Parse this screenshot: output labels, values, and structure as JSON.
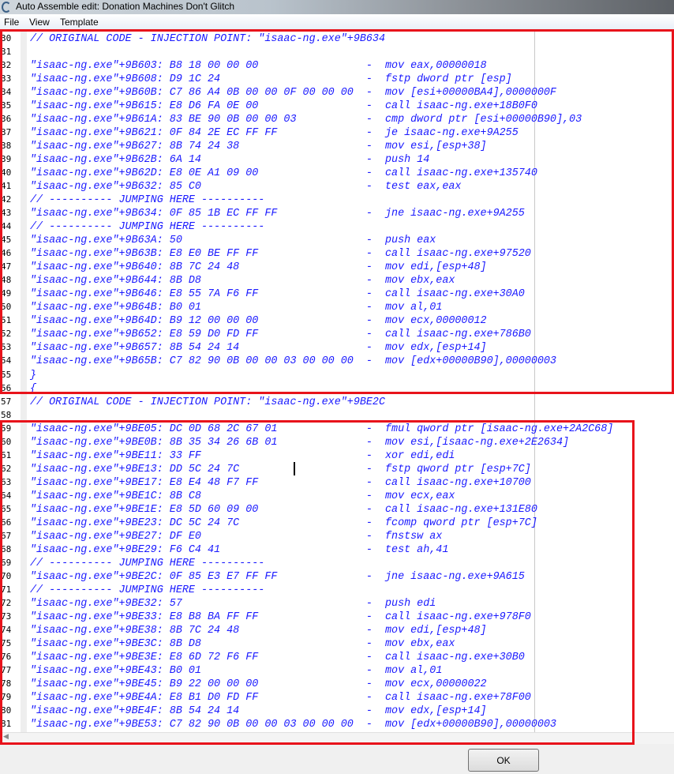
{
  "window": {
    "title": "Auto Assemble edit: Donation Machines Don't Glitch"
  },
  "menu": [
    "File",
    "View",
    "Template"
  ],
  "lines": [
    {
      "n": "30",
      "t": "// ORIGINAL CODE - INJECTION POINT: \"isaac-ng.exe\"+9B634"
    },
    {
      "n": "31",
      "t": ""
    },
    {
      "n": "32",
      "t": "\"isaac-ng.exe\"+9B603: B8 18 00 00 00                 -  mov eax,00000018"
    },
    {
      "n": "33",
      "t": "\"isaac-ng.exe\"+9B608: D9 1C 24                       -  fstp dword ptr [esp]"
    },
    {
      "n": "34",
      "t": "\"isaac-ng.exe\"+9B60B: C7 86 A4 0B 00 00 0F 00 00 00  -  mov [esi+00000BA4],0000000F"
    },
    {
      "n": "35",
      "t": "\"isaac-ng.exe\"+9B615: E8 D6 FA 0E 00                 -  call isaac-ng.exe+18B0F0"
    },
    {
      "n": "36",
      "t": "\"isaac-ng.exe\"+9B61A: 83 BE 90 0B 00 00 03           -  cmp dword ptr [esi+00000B90],03"
    },
    {
      "n": "37",
      "t": "\"isaac-ng.exe\"+9B621: 0F 84 2E EC FF FF              -  je isaac-ng.exe+9A255"
    },
    {
      "n": "38",
      "t": "\"isaac-ng.exe\"+9B627: 8B 74 24 38                    -  mov esi,[esp+38]"
    },
    {
      "n": "39",
      "t": "\"isaac-ng.exe\"+9B62B: 6A 14                          -  push 14"
    },
    {
      "n": "40",
      "t": "\"isaac-ng.exe\"+9B62D: E8 0E A1 09 00                 -  call isaac-ng.exe+135740"
    },
    {
      "n": "41",
      "t": "\"isaac-ng.exe\"+9B632: 85 C0                          -  test eax,eax"
    },
    {
      "n": "42",
      "t": "// ---------- JUMPING HERE ----------"
    },
    {
      "n": "43",
      "t": "\"isaac-ng.exe\"+9B634: 0F 85 1B EC FF FF              -  jne isaac-ng.exe+9A255"
    },
    {
      "n": "44",
      "t": "// ---------- JUMPING HERE ----------"
    },
    {
      "n": "45",
      "t": "\"isaac-ng.exe\"+9B63A: 50                             -  push eax"
    },
    {
      "n": "46",
      "t": "\"isaac-ng.exe\"+9B63B: E8 E0 BE FF FF                 -  call isaac-ng.exe+97520"
    },
    {
      "n": "47",
      "t": "\"isaac-ng.exe\"+9B640: 8B 7C 24 48                    -  mov edi,[esp+48]"
    },
    {
      "n": "48",
      "t": "\"isaac-ng.exe\"+9B644: 8B D8                          -  mov ebx,eax"
    },
    {
      "n": "49",
      "t": "\"isaac-ng.exe\"+9B646: E8 55 7A F6 FF                 -  call isaac-ng.exe+30A0"
    },
    {
      "n": "50",
      "t": "\"isaac-ng.exe\"+9B64B: B0 01                          -  mov al,01"
    },
    {
      "n": "51",
      "t": "\"isaac-ng.exe\"+9B64D: B9 12 00 00 00                 -  mov ecx,00000012"
    },
    {
      "n": "52",
      "t": "\"isaac-ng.exe\"+9B652: E8 59 D0 FD FF                 -  call isaac-ng.exe+786B0"
    },
    {
      "n": "53",
      "t": "\"isaac-ng.exe\"+9B657: 8B 54 24 14                    -  mov edx,[esp+14]"
    },
    {
      "n": "54",
      "t": "\"isaac-ng.exe\"+9B65B: C7 82 90 0B 00 00 03 00 00 00  -  mov [edx+00000B90],00000003"
    },
    {
      "n": "55",
      "t": "}"
    },
    {
      "n": "56",
      "t": "{"
    },
    {
      "n": "57",
      "t": "// ORIGINAL CODE - INJECTION POINT: \"isaac-ng.exe\"+9BE2C"
    },
    {
      "n": "58",
      "t": ""
    },
    {
      "n": "59",
      "t": "\"isaac-ng.exe\"+9BE05: DC 0D 68 2C 67 01              -  fmul qword ptr [isaac-ng.exe+2A2C68]"
    },
    {
      "n": "60",
      "t": "\"isaac-ng.exe\"+9BE0B: 8B 35 34 26 6B 01              -  mov esi,[isaac-ng.exe+2E2634]"
    },
    {
      "n": "61",
      "t": "\"isaac-ng.exe\"+9BE11: 33 FF                          -  xor edi,edi"
    },
    {
      "n": "62",
      "t": "\"isaac-ng.exe\"+9BE13: DD 5C 24 7C                    -  fstp qword ptr [esp+7C]"
    },
    {
      "n": "63",
      "t": "\"isaac-ng.exe\"+9BE17: E8 E4 48 F7 FF                 -  call isaac-ng.exe+10700"
    },
    {
      "n": "64",
      "t": "\"isaac-ng.exe\"+9BE1C: 8B C8                          -  mov ecx,eax"
    },
    {
      "n": "65",
      "t": "\"isaac-ng.exe\"+9BE1E: E8 5D 60 09 00                 -  call isaac-ng.exe+131E80"
    },
    {
      "n": "66",
      "t": "\"isaac-ng.exe\"+9BE23: DC 5C 24 7C                    -  fcomp qword ptr [esp+7C]"
    },
    {
      "n": "67",
      "t": "\"isaac-ng.exe\"+9BE27: DF E0                          -  fnstsw ax"
    },
    {
      "n": "68",
      "t": "\"isaac-ng.exe\"+9BE29: F6 C4 41                       -  test ah,41"
    },
    {
      "n": "69",
      "t": "// ---------- JUMPING HERE ----------"
    },
    {
      "n": "70",
      "t": "\"isaac-ng.exe\"+9BE2C: 0F 85 E3 E7 FF FF              -  jne isaac-ng.exe+9A615"
    },
    {
      "n": "71",
      "t": "// ---------- JUMPING HERE ----------"
    },
    {
      "n": "72",
      "t": "\"isaac-ng.exe\"+9BE32: 57                             -  push edi"
    },
    {
      "n": "73",
      "t": "\"isaac-ng.exe\"+9BE33: E8 B8 BA FF FF                 -  call isaac-ng.exe+978F0"
    },
    {
      "n": "74",
      "t": "\"isaac-ng.exe\"+9BE38: 8B 7C 24 48                    -  mov edi,[esp+48]"
    },
    {
      "n": "75",
      "t": "\"isaac-ng.exe\"+9BE3C: 8B D8                          -  mov ebx,eax"
    },
    {
      "n": "76",
      "t": "\"isaac-ng.exe\"+9BE3E: E8 6D 72 F6 FF                 -  call isaac-ng.exe+30B0"
    },
    {
      "n": "77",
      "t": "\"isaac-ng.exe\"+9BE43: B0 01                          -  mov al,01"
    },
    {
      "n": "78",
      "t": "\"isaac-ng.exe\"+9BE45: B9 22 00 00 00                 -  mov ecx,00000022"
    },
    {
      "n": "79",
      "t": "\"isaac-ng.exe\"+9BE4A: E8 B1 D0 FD FF                 -  call isaac-ng.exe+78F00"
    },
    {
      "n": "80",
      "t": "\"isaac-ng.exe\"+9BE4F: 8B 54 24 14                    -  mov edx,[esp+14]"
    },
    {
      "n": "81",
      "t": "\"isaac-ng.exe\"+9BE53: C7 82 90 0B 00 00 03 00 00 00  -  mov [edx+00000B90],00000003"
    }
  ],
  "buttons": {
    "ok": "OK"
  },
  "colors": {
    "code": "#1a1aff",
    "highlight_box": "#e8131b"
  }
}
